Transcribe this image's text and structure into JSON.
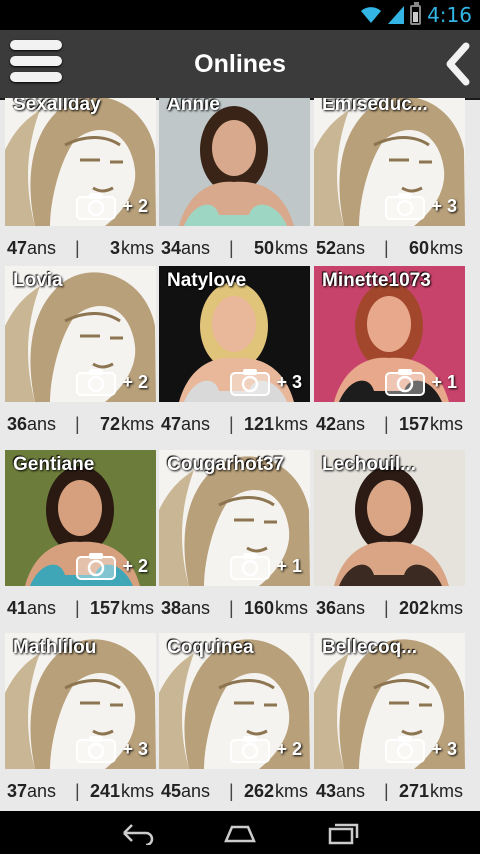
{
  "status": {
    "time": "4:16"
  },
  "header": {
    "title": "Onlines"
  },
  "units": {
    "age": "ans",
    "distance": "kms"
  },
  "colors": {
    "accent": "#33b5e5",
    "header_bg": "#3b3b3b",
    "silhouette": "#b8a07a"
  },
  "profiles": [
    {
      "name": "Sexallday",
      "age": "47",
      "distance": "3",
      "photos": "+ 2",
      "photo": "silhouette"
    },
    {
      "name": "Annie",
      "age": "34",
      "distance": "50",
      "photos": "",
      "photo": "portrait-brunette"
    },
    {
      "name": "Emiseduc...",
      "age": "52",
      "distance": "60",
      "photos": "+ 3",
      "photo": "silhouette"
    },
    {
      "name": "Lovia",
      "age": "36",
      "distance": "72",
      "photos": "+ 2",
      "photo": "silhouette"
    },
    {
      "name": "Natylove",
      "age": "47",
      "distance": "121",
      "photos": "+ 3",
      "photo": "portrait-blonde"
    },
    {
      "name": "Minette1073",
      "age": "42",
      "distance": "157",
      "photos": "+ 1",
      "photo": "portrait-redhead"
    },
    {
      "name": "Gentiane",
      "age": "41",
      "distance": "157",
      "photos": "+ 2",
      "photo": "portrait-dark"
    },
    {
      "name": "Cougarhot37",
      "age": "38",
      "distance": "160",
      "photos": "+ 1",
      "photo": "silhouette"
    },
    {
      "name": "Lechouil...",
      "age": "36",
      "distance": "202",
      "photos": "",
      "photo": "portrait-brunette2"
    },
    {
      "name": "Mathlilou",
      "age": "37",
      "distance": "241",
      "photos": "+ 3",
      "photo": "silhouette"
    },
    {
      "name": "Coquinea",
      "age": "45",
      "distance": "262",
      "photos": "+ 2",
      "photo": "silhouette"
    },
    {
      "name": "Bellecoq...",
      "age": "43",
      "distance": "271",
      "photos": "+ 3",
      "photo": "silhouette"
    }
  ]
}
